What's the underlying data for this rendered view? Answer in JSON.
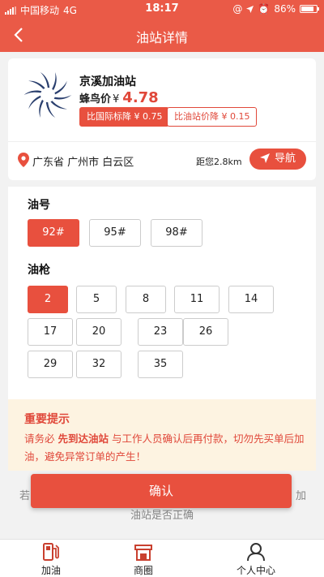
{
  "statusbar": {
    "carrier": "中国移动",
    "network": "4G",
    "time": "18:17",
    "battery": "86%",
    "battery_level": 0.86
  },
  "navbar": {
    "title": "油站详情",
    "back_icon": "chevron-left-icon"
  },
  "station": {
    "name": "京溪加油站",
    "price_label": "蜂鸟价",
    "currency": "¥",
    "price": "4.78",
    "tag_national": "比国际标降 ¥ 0.75",
    "tag_station": "比油站价降 ¥ 0.15",
    "address": "广东省 广州市 白云区",
    "distance": "距您2.8km",
    "nav_label": "导航"
  },
  "fuel": {
    "title": "油号",
    "options": [
      "92#",
      "95#",
      "98#"
    ],
    "selected": "92#"
  },
  "gun": {
    "title": "油枪",
    "options": [
      "2",
      "5",
      "8",
      "11",
      "14",
      "17",
      "20",
      "23",
      "26",
      "29",
      "32",
      "35"
    ],
    "selected": "2"
  },
  "notice": {
    "title": "重要提示",
    "text_a": "请务必 ",
    "text_b": "先到达油站",
    "text_c": " 与工作人员确认后再付款，切勿先买单后加油，避免异常订单的产生！"
  },
  "behind": {
    "left": "若",
    "right": "加",
    "line2": "油站是否正确"
  },
  "confirm_label": "确认",
  "tabs": [
    {
      "label": "加油",
      "icon": "fuel-pump-icon"
    },
    {
      "label": "商圈",
      "icon": "shop-icon"
    },
    {
      "label": "个人中心",
      "icon": "user-icon"
    }
  ],
  "colors": {
    "accent": "#e8503e",
    "notice_bg": "#fdf3e1"
  }
}
